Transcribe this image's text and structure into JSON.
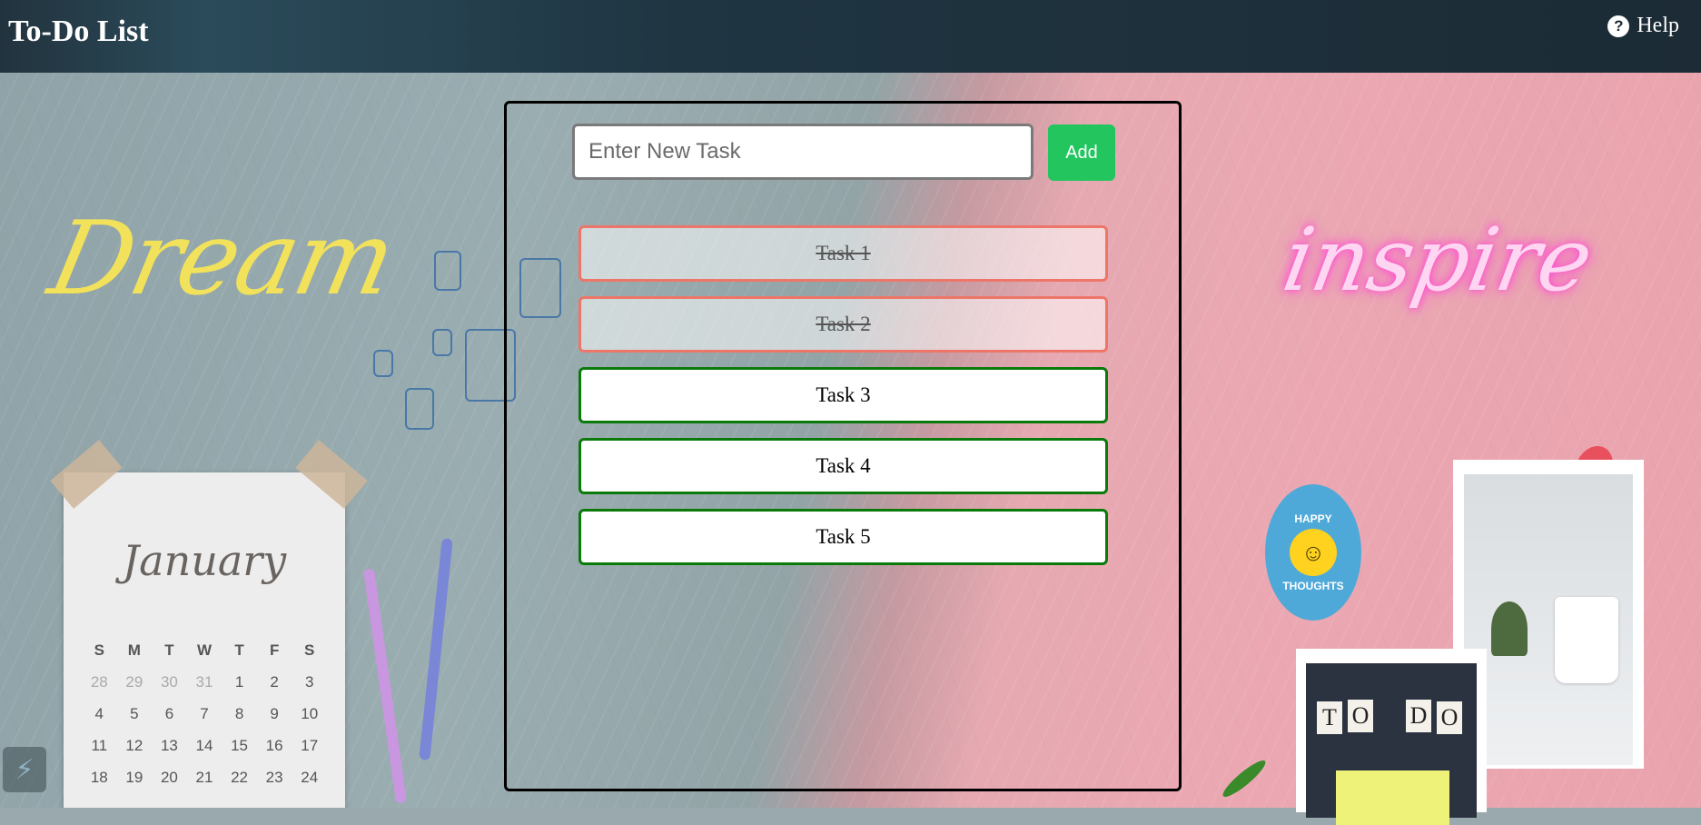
{
  "header": {
    "title": "To-Do List",
    "help_label": "Help"
  },
  "decor": {
    "dream_text": "Dream",
    "inspire_text": "inspire",
    "badge_top": "HAPPY",
    "badge_bottom": "THOUGHTS",
    "calendar": {
      "month": "January",
      "day_headers": [
        "S",
        "M",
        "T",
        "W",
        "T",
        "F",
        "S"
      ],
      "rows": [
        [
          "28",
          "29",
          "30",
          "31",
          "1",
          "2",
          "3"
        ],
        [
          "4",
          "5",
          "6",
          "7",
          "8",
          "9",
          "10"
        ],
        [
          "11",
          "12",
          "13",
          "14",
          "15",
          "16",
          "17"
        ],
        [
          "18",
          "19",
          "20",
          "21",
          "22",
          "23",
          "24"
        ]
      ]
    },
    "todo_tiles": [
      "T",
      "O",
      "D",
      "O"
    ]
  },
  "form": {
    "placeholder": "Enter New Task",
    "value": "",
    "add_label": "Add"
  },
  "tasks": [
    {
      "label": "Task 1",
      "completed": true
    },
    {
      "label": "Task 2",
      "completed": true
    },
    {
      "label": "Task 3",
      "completed": false
    },
    {
      "label": "Task 4",
      "completed": false
    },
    {
      "label": "Task 5",
      "completed": false
    }
  ],
  "colors": {
    "add_button": "#22c55e",
    "completed_border": "#ee7668",
    "open_border": "#0a7a0a",
    "header_bg": "#1c2b35"
  }
}
